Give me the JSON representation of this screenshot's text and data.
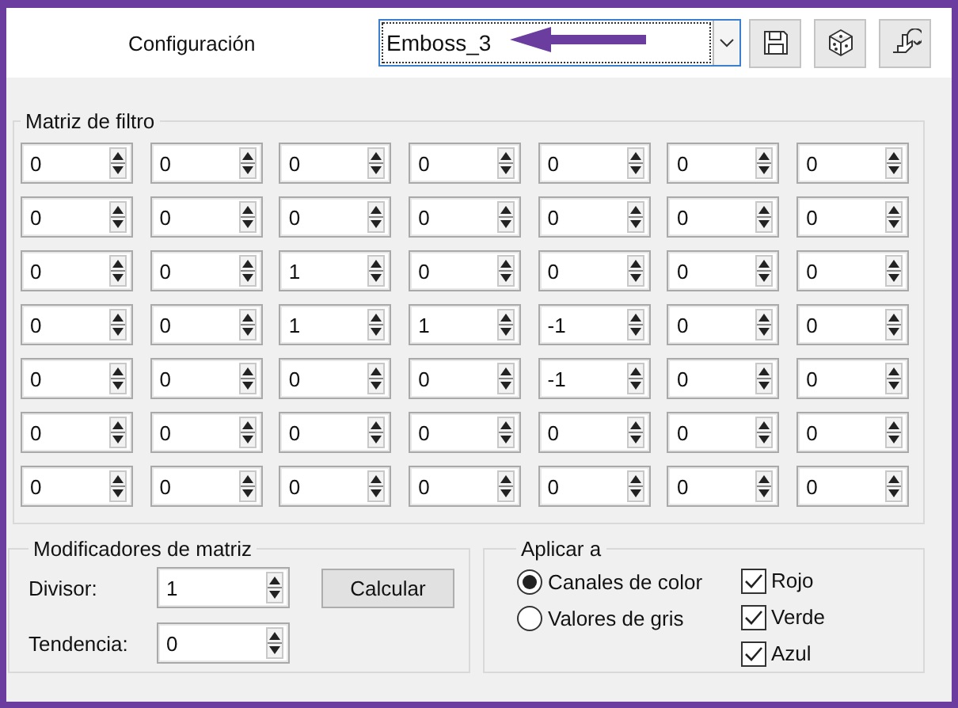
{
  "header": {
    "label": "Configuración",
    "preset": "Emboss_3"
  },
  "matrix": {
    "title": "Matriz de filtro",
    "rows": [
      [
        "0",
        "0",
        "0",
        "0",
        "0",
        "0",
        "0"
      ],
      [
        "0",
        "0",
        "0",
        "0",
        "0",
        "0",
        "0"
      ],
      [
        "0",
        "0",
        "1",
        "0",
        "0",
        "0",
        "0"
      ],
      [
        "0",
        "0",
        "1",
        "1",
        "-1",
        "0",
        "0"
      ],
      [
        "0",
        "0",
        "0",
        "0",
        "-1",
        "0",
        "0"
      ],
      [
        "0",
        "0",
        "0",
        "0",
        "0",
        "0",
        "0"
      ],
      [
        "0",
        "0",
        "0",
        "0",
        "0",
        "0",
        "0"
      ]
    ]
  },
  "modifiers": {
    "title": "Modificadores de matriz",
    "fields": [
      {
        "label": "Divisor:",
        "value": "1"
      },
      {
        "label": "Tendencia:",
        "value": "0"
      }
    ],
    "button": "Calcular"
  },
  "apply": {
    "title": "Aplicar a",
    "radios": [
      {
        "label": "Canales de color",
        "selected": true
      },
      {
        "label": "Valores de gris",
        "selected": false
      }
    ],
    "checks": [
      {
        "label": "Rojo",
        "checked": true
      },
      {
        "label": "Verde",
        "checked": true
      },
      {
        "label": "Azul",
        "checked": true
      }
    ]
  }
}
